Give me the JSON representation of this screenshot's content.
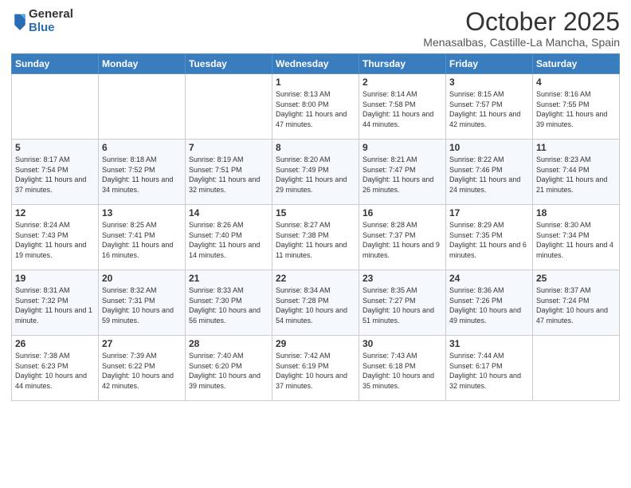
{
  "logo": {
    "general": "General",
    "blue": "Blue"
  },
  "header": {
    "month": "October 2025",
    "location": "Menasalbas, Castille-La Mancha, Spain"
  },
  "weekdays": [
    "Sunday",
    "Monday",
    "Tuesday",
    "Wednesday",
    "Thursday",
    "Friday",
    "Saturday"
  ],
  "weeks": [
    [
      {
        "day": "",
        "info": ""
      },
      {
        "day": "",
        "info": ""
      },
      {
        "day": "",
        "info": ""
      },
      {
        "day": "1",
        "info": "Sunrise: 8:13 AM\nSunset: 8:00 PM\nDaylight: 11 hours and 47 minutes."
      },
      {
        "day": "2",
        "info": "Sunrise: 8:14 AM\nSunset: 7:58 PM\nDaylight: 11 hours and 44 minutes."
      },
      {
        "day": "3",
        "info": "Sunrise: 8:15 AM\nSunset: 7:57 PM\nDaylight: 11 hours and 42 minutes."
      },
      {
        "day": "4",
        "info": "Sunrise: 8:16 AM\nSunset: 7:55 PM\nDaylight: 11 hours and 39 minutes."
      }
    ],
    [
      {
        "day": "5",
        "info": "Sunrise: 8:17 AM\nSunset: 7:54 PM\nDaylight: 11 hours and 37 minutes."
      },
      {
        "day": "6",
        "info": "Sunrise: 8:18 AM\nSunset: 7:52 PM\nDaylight: 11 hours and 34 minutes."
      },
      {
        "day": "7",
        "info": "Sunrise: 8:19 AM\nSunset: 7:51 PM\nDaylight: 11 hours and 32 minutes."
      },
      {
        "day": "8",
        "info": "Sunrise: 8:20 AM\nSunset: 7:49 PM\nDaylight: 11 hours and 29 minutes."
      },
      {
        "day": "9",
        "info": "Sunrise: 8:21 AM\nSunset: 7:47 PM\nDaylight: 11 hours and 26 minutes."
      },
      {
        "day": "10",
        "info": "Sunrise: 8:22 AM\nSunset: 7:46 PM\nDaylight: 11 hours and 24 minutes."
      },
      {
        "day": "11",
        "info": "Sunrise: 8:23 AM\nSunset: 7:44 PM\nDaylight: 11 hours and 21 minutes."
      }
    ],
    [
      {
        "day": "12",
        "info": "Sunrise: 8:24 AM\nSunset: 7:43 PM\nDaylight: 11 hours and 19 minutes."
      },
      {
        "day": "13",
        "info": "Sunrise: 8:25 AM\nSunset: 7:41 PM\nDaylight: 11 hours and 16 minutes."
      },
      {
        "day": "14",
        "info": "Sunrise: 8:26 AM\nSunset: 7:40 PM\nDaylight: 11 hours and 14 minutes."
      },
      {
        "day": "15",
        "info": "Sunrise: 8:27 AM\nSunset: 7:38 PM\nDaylight: 11 hours and 11 minutes."
      },
      {
        "day": "16",
        "info": "Sunrise: 8:28 AM\nSunset: 7:37 PM\nDaylight: 11 hours and 9 minutes."
      },
      {
        "day": "17",
        "info": "Sunrise: 8:29 AM\nSunset: 7:35 PM\nDaylight: 11 hours and 6 minutes."
      },
      {
        "day": "18",
        "info": "Sunrise: 8:30 AM\nSunset: 7:34 PM\nDaylight: 11 hours and 4 minutes."
      }
    ],
    [
      {
        "day": "19",
        "info": "Sunrise: 8:31 AM\nSunset: 7:32 PM\nDaylight: 11 hours and 1 minute."
      },
      {
        "day": "20",
        "info": "Sunrise: 8:32 AM\nSunset: 7:31 PM\nDaylight: 10 hours and 59 minutes."
      },
      {
        "day": "21",
        "info": "Sunrise: 8:33 AM\nSunset: 7:30 PM\nDaylight: 10 hours and 56 minutes."
      },
      {
        "day": "22",
        "info": "Sunrise: 8:34 AM\nSunset: 7:28 PM\nDaylight: 10 hours and 54 minutes."
      },
      {
        "day": "23",
        "info": "Sunrise: 8:35 AM\nSunset: 7:27 PM\nDaylight: 10 hours and 51 minutes."
      },
      {
        "day": "24",
        "info": "Sunrise: 8:36 AM\nSunset: 7:26 PM\nDaylight: 10 hours and 49 minutes."
      },
      {
        "day": "25",
        "info": "Sunrise: 8:37 AM\nSunset: 7:24 PM\nDaylight: 10 hours and 47 minutes."
      }
    ],
    [
      {
        "day": "26",
        "info": "Sunrise: 7:38 AM\nSunset: 6:23 PM\nDaylight: 10 hours and 44 minutes."
      },
      {
        "day": "27",
        "info": "Sunrise: 7:39 AM\nSunset: 6:22 PM\nDaylight: 10 hours and 42 minutes."
      },
      {
        "day": "28",
        "info": "Sunrise: 7:40 AM\nSunset: 6:20 PM\nDaylight: 10 hours and 39 minutes."
      },
      {
        "day": "29",
        "info": "Sunrise: 7:42 AM\nSunset: 6:19 PM\nDaylight: 10 hours and 37 minutes."
      },
      {
        "day": "30",
        "info": "Sunrise: 7:43 AM\nSunset: 6:18 PM\nDaylight: 10 hours and 35 minutes."
      },
      {
        "day": "31",
        "info": "Sunrise: 7:44 AM\nSunset: 6:17 PM\nDaylight: 10 hours and 32 minutes."
      },
      {
        "day": "",
        "info": ""
      }
    ]
  ]
}
